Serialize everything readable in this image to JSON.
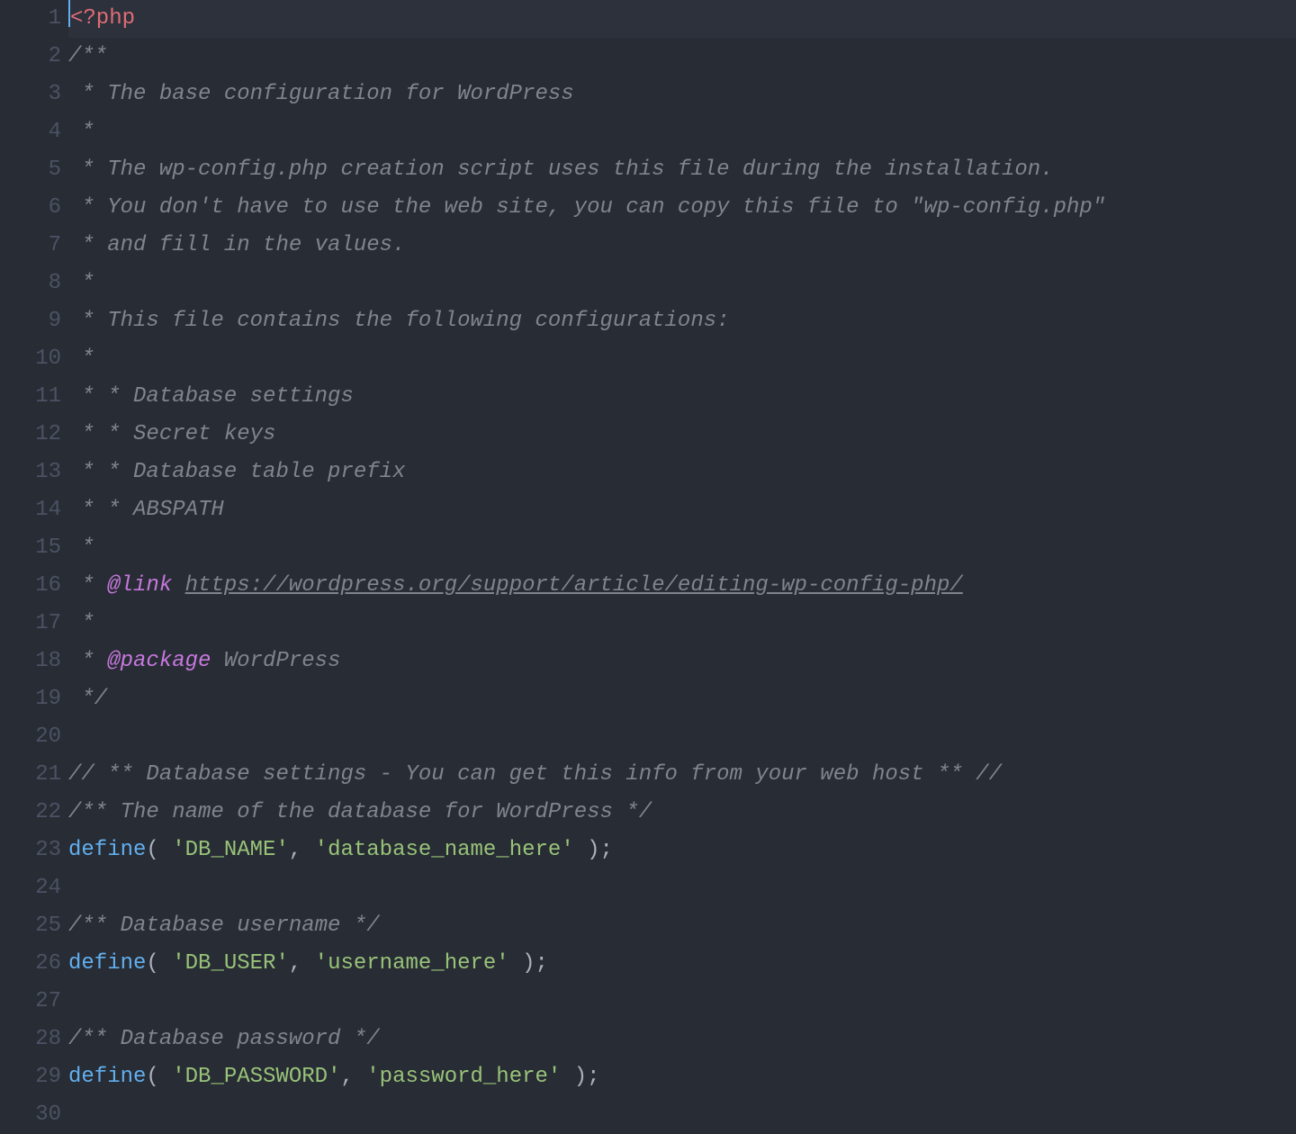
{
  "editor": {
    "theme": "one-dark",
    "cursor_line": 1,
    "last_line_number": 30,
    "lines": [
      {
        "n": 1,
        "hl": true,
        "tokens": [
          {
            "cls": "cursor",
            "t": ""
          },
          {
            "cls": "c-tag",
            "t": "<?php"
          }
        ]
      },
      {
        "n": 2,
        "tokens": [
          {
            "cls": "c-com",
            "t": "/**"
          }
        ]
      },
      {
        "n": 3,
        "tokens": [
          {
            "cls": "c-com",
            "t": " * The base configuration for WordPress"
          }
        ]
      },
      {
        "n": 4,
        "tokens": [
          {
            "cls": "c-com",
            "t": " *"
          }
        ]
      },
      {
        "n": 5,
        "tokens": [
          {
            "cls": "c-com",
            "t": " * The wp-config.php creation script uses this file during the installation."
          }
        ]
      },
      {
        "n": 6,
        "tokens": [
          {
            "cls": "c-com",
            "t": " * You don't have to use the web site, you can copy this file to \"wp-config.php\""
          }
        ]
      },
      {
        "n": 7,
        "tokens": [
          {
            "cls": "c-com",
            "t": " * and fill in the values."
          }
        ]
      },
      {
        "n": 8,
        "tokens": [
          {
            "cls": "c-com",
            "t": " *"
          }
        ]
      },
      {
        "n": 9,
        "tokens": [
          {
            "cls": "c-com",
            "t": " * This file contains the following configurations:"
          }
        ]
      },
      {
        "n": 10,
        "tokens": [
          {
            "cls": "c-com",
            "t": " *"
          }
        ]
      },
      {
        "n": 11,
        "tokens": [
          {
            "cls": "c-com",
            "t": " * * Database settings"
          }
        ]
      },
      {
        "n": 12,
        "tokens": [
          {
            "cls": "c-com",
            "t": " * * Secret keys"
          }
        ]
      },
      {
        "n": 13,
        "tokens": [
          {
            "cls": "c-com",
            "t": " * * Database table prefix"
          }
        ]
      },
      {
        "n": 14,
        "tokens": [
          {
            "cls": "c-com",
            "t": " * * ABSPATH"
          }
        ]
      },
      {
        "n": 15,
        "tokens": [
          {
            "cls": "c-com",
            "t": " *"
          }
        ]
      },
      {
        "n": 16,
        "tokens": [
          {
            "cls": "c-com",
            "t": " * "
          },
          {
            "cls": "c-doc",
            "t": "@link"
          },
          {
            "cls": "c-com",
            "t": " "
          },
          {
            "cls": "c-url",
            "t": "https://wordpress.org/support/article/editing-wp-config-php/"
          }
        ]
      },
      {
        "n": 17,
        "tokens": [
          {
            "cls": "c-com",
            "t": " *"
          }
        ]
      },
      {
        "n": 18,
        "tokens": [
          {
            "cls": "c-com",
            "t": " * "
          },
          {
            "cls": "c-doc",
            "t": "@package"
          },
          {
            "cls": "c-com",
            "t": " WordPress"
          }
        ]
      },
      {
        "n": 19,
        "tokens": [
          {
            "cls": "c-com",
            "t": " */"
          }
        ]
      },
      {
        "n": 20,
        "tokens": []
      },
      {
        "n": 21,
        "tokens": [
          {
            "cls": "c-com",
            "t": "// ** Database settings - You can get this info from your web host ** //"
          }
        ]
      },
      {
        "n": 22,
        "tokens": [
          {
            "cls": "c-com",
            "t": "/** The name of the database for WordPress */"
          }
        ]
      },
      {
        "n": 23,
        "tokens": [
          {
            "cls": "c-kw",
            "t": "define"
          },
          {
            "cls": "c-par",
            "t": "( "
          },
          {
            "cls": "c-str",
            "t": "'DB_NAME'"
          },
          {
            "cls": "c-par",
            "t": ", "
          },
          {
            "cls": "c-str",
            "t": "'database_name_here'"
          },
          {
            "cls": "c-par",
            "t": " );"
          }
        ]
      },
      {
        "n": 24,
        "tokens": []
      },
      {
        "n": 25,
        "tokens": [
          {
            "cls": "c-com",
            "t": "/** Database username */"
          }
        ]
      },
      {
        "n": 26,
        "tokens": [
          {
            "cls": "c-kw",
            "t": "define"
          },
          {
            "cls": "c-par",
            "t": "( "
          },
          {
            "cls": "c-str",
            "t": "'DB_USER'"
          },
          {
            "cls": "c-par",
            "t": ", "
          },
          {
            "cls": "c-str",
            "t": "'username_here'"
          },
          {
            "cls": "c-par",
            "t": " );"
          }
        ]
      },
      {
        "n": 27,
        "tokens": []
      },
      {
        "n": 28,
        "tokens": [
          {
            "cls": "c-com",
            "t": "/** Database password */"
          }
        ]
      },
      {
        "n": 29,
        "tokens": [
          {
            "cls": "c-kw",
            "t": "define"
          },
          {
            "cls": "c-par",
            "t": "( "
          },
          {
            "cls": "c-str",
            "t": "'DB_PASSWORD'"
          },
          {
            "cls": "c-par",
            "t": ", "
          },
          {
            "cls": "c-str",
            "t": "'password_here'"
          },
          {
            "cls": "c-par",
            "t": " );"
          }
        ]
      },
      {
        "n": 30,
        "tokens": []
      }
    ]
  }
}
